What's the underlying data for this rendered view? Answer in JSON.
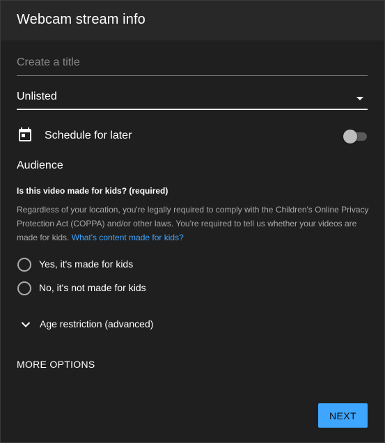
{
  "header": {
    "title": "Webcam stream info"
  },
  "form": {
    "title_placeholder": "Create a title",
    "title_value": "",
    "visibility": {
      "selected": "Unlisted"
    },
    "schedule": {
      "label": "Schedule for later",
      "enabled": false
    }
  },
  "audience": {
    "heading": "Audience",
    "question": "Is this video made for kids? (required)",
    "description": "Regardless of your location, you're legally required to comply with the Children's Online Privacy Protection Act (COPPA) and/or other laws. You're required to tell us whether your videos are made for kids. ",
    "link_text": "What's content made for kids?",
    "options": [
      {
        "label": "Yes, it's made for kids",
        "selected": false
      },
      {
        "label": "No, it's not made for kids",
        "selected": false
      }
    ]
  },
  "age_restriction": {
    "label": "Age restriction (advanced)"
  },
  "more_options": {
    "label": "MORE OPTIONS"
  },
  "footer": {
    "next_label": "NEXT"
  },
  "colors": {
    "accent": "#3ea6ff",
    "background": "#1f1f1f",
    "header": "#282828",
    "muted_text": "#aaaaaa"
  },
  "icons": {
    "schedule": "calendar-icon",
    "age_restriction": "chevron-down-icon",
    "visibility": "dropdown-arrow-icon"
  }
}
